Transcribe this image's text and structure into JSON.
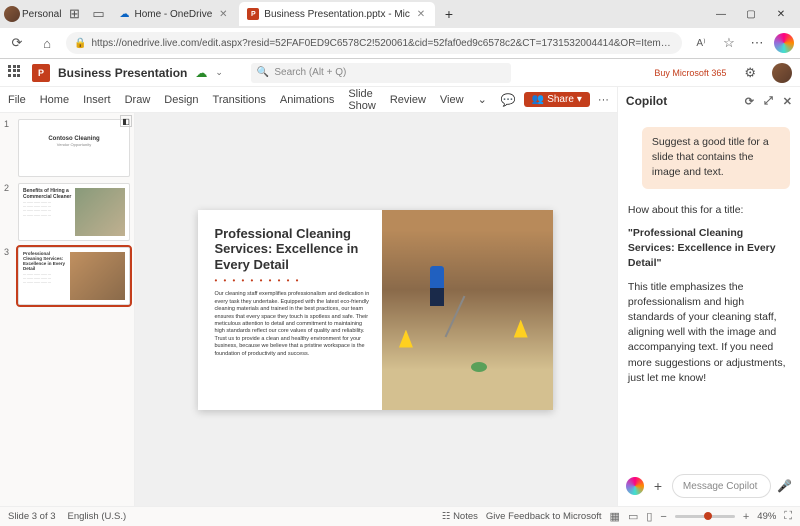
{
  "browser": {
    "profile": "Personal",
    "tabs": [
      {
        "label": "Home - OneDrive",
        "active": false
      },
      {
        "label": "Business Presentation.pptx - Mic",
        "active": true
      }
    ],
    "url": "https://onedrive.live.com/edit.aspx?resid=52FAF0ED9C6578C2!520061&cid=52faf0ed9c6578c2&CT=1731532004414&OR=ItemsView"
  },
  "app": {
    "doc_title": "Business Presentation",
    "search_placeholder": "Search (Alt + Q)",
    "buy_label": "Buy Microsoft 365",
    "ribbon": [
      "File",
      "Home",
      "Insert",
      "Draw",
      "Design",
      "Transitions",
      "Animations",
      "Slide Show",
      "Review",
      "View"
    ],
    "share_label": "Share",
    "more_label": "···",
    "chevron": "⌄"
  },
  "thumbs": [
    {
      "n": "1",
      "title": "Contoso Cleaning",
      "sub": "Vendor Opportunity"
    },
    {
      "n": "2",
      "title": "Benefits of Hiring a Commercial Cleaner",
      "body": "……………………\n……………………\n……………………\n……………………"
    },
    {
      "n": "3",
      "title": "Professional Cleaning Services: Excellence in Every Detail",
      "body": "……………………\n……………………\n……………………"
    }
  ],
  "slide": {
    "heading": "Professional Cleaning Services: Excellence in Every Detail",
    "body": "Our cleaning staff exemplifies professionalism and dedication in every task they undertake. Equipped with the latest eco-friendly cleaning materials and trained in the best practices, our team ensures that every space they touch is spotless and safe. Their meticulous attention to detail and commitment to maintaining high standards reflect our core values of quality and reliability. Trust us to provide a clean and healthy environment for your business, because we believe that a pristine workspace is the foundation of productivity and success."
  },
  "copilot": {
    "title": "Copilot",
    "user_msg": "Suggest a good title for a slide that contains the image and text.",
    "intro": "How about this for a title:",
    "suggestion": "\"Professional Cleaning Services: Excellence in Every Detail\"",
    "explain": "This title emphasizes the professionalism and high standards of your cleaning staff, aligning well with the image and accompanying text. If you need more suggestions or adjustments, just let me know!",
    "input_placeholder": "Message Copilot"
  },
  "status": {
    "slide_info": "Slide 3 of 3",
    "lang": "English (U.S.)",
    "notes": "Notes",
    "feedback": "Give Feedback to Microsoft",
    "zoom": "49%"
  }
}
